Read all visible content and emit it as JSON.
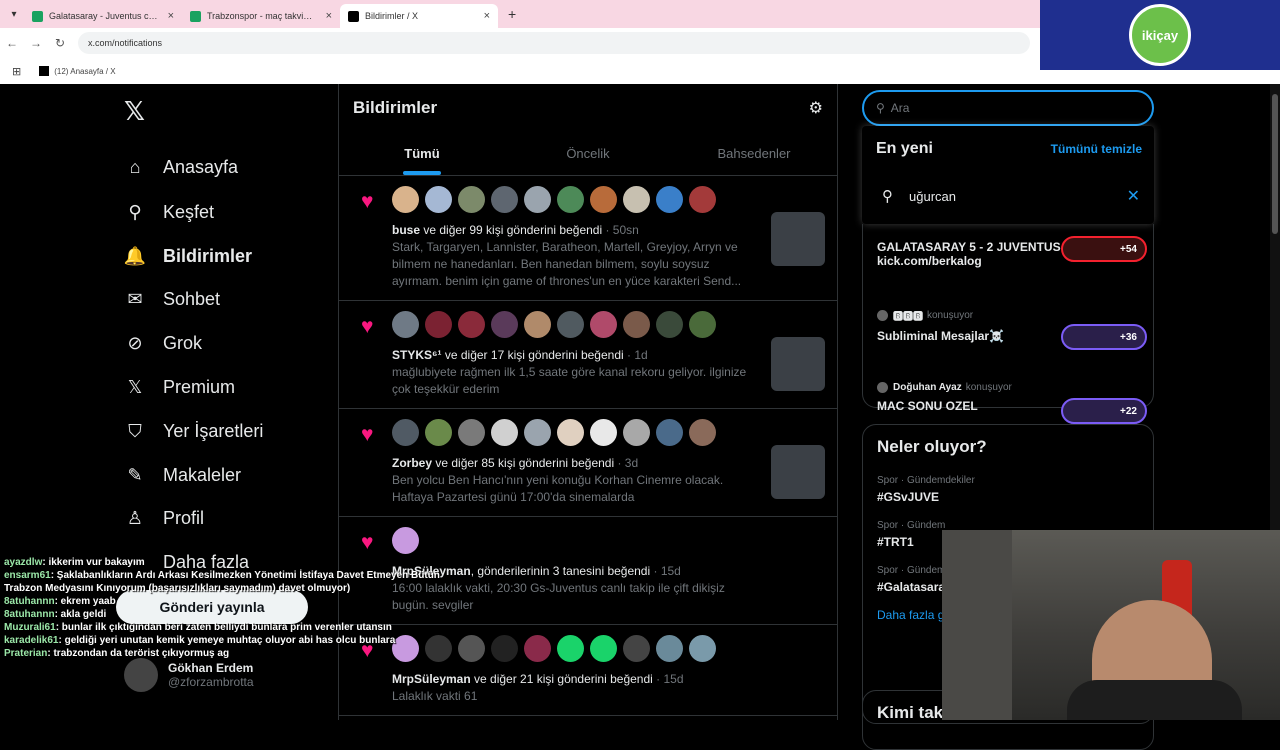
{
  "browser": {
    "tabs": [
      {
        "title": "Galatasaray - Juventus canlı sko",
        "color": "#1aa260",
        "active": false
      },
      {
        "title": "Trabzonspor - maç takvimi, takı",
        "color": "#1aa260",
        "active": false
      },
      {
        "title": "Bildirimler / X",
        "color": "#000000",
        "active": true
      }
    ],
    "new_tab": "+",
    "url": "x.com/notifications",
    "bookmark": "(12) Anasayfa / X"
  },
  "overlay": {
    "logo_text": "ikiçay"
  },
  "nav": {
    "items": [
      {
        "label": "Anasayfa",
        "icon": "home-icon",
        "glyph": "⌂"
      },
      {
        "label": "Keşfet",
        "icon": "search-icon",
        "glyph": "⚲"
      },
      {
        "label": "Bildirimler",
        "icon": "bell-icon",
        "glyph": "🔔"
      },
      {
        "label": "Sohbet",
        "icon": "mail-icon",
        "glyph": "✉"
      },
      {
        "label": "Grok",
        "icon": "grok-icon",
        "glyph": "⊘"
      },
      {
        "label": "Premium",
        "icon": "x-icon",
        "glyph": "𝕏"
      },
      {
        "label": "Yer İşaretleri",
        "icon": "bookmark-icon",
        "glyph": "⛉"
      },
      {
        "label": "Makaleler",
        "icon": "article-icon",
        "glyph": "✎"
      },
      {
        "label": "Profil",
        "icon": "profile-icon",
        "glyph": "♙"
      },
      {
        "label": "Daha fazla",
        "icon": "more-icon",
        "glyph": "⋯"
      }
    ],
    "post_button": "Gönderi yayınla",
    "user": {
      "name": "Gökhan Erdem",
      "handle": "@zforzambrotta"
    }
  },
  "chat": [
    {
      "name": "ayazdlw",
      "msg": ": ikkerim vur bakayım"
    },
    {
      "name": "ensarm61",
      "msg": ": Şaklabanlıkların Ardı Arkası Kesilmezken Yönetimi İstifaya Davet Etmeyen Bütün Trabzon Medyasını Kınıyorum (başarısızlıkları saymadım) davet olmuyor)"
    },
    {
      "name": "8atuhannn",
      "msg": ": ekrem yaab"
    },
    {
      "name": "8atuhannn",
      "msg": ": akla geldi"
    },
    {
      "name": "Muzurali61",
      "msg": ": bunlar ilk çıktığından beri zaten belliydi bunlara prim verenler utansın"
    },
    {
      "name": "karadelik61",
      "msg": ": geldiği yeri unutan kemik yemeye muhtaç oluyor abi has olcu bunlara"
    },
    {
      "name": "Praterian",
      "msg": ": trabzondan da terörist çıkıyormuş ag"
    }
  ],
  "main": {
    "title": "Bildirimler",
    "tabs": [
      "Tümü",
      "Öncelik",
      "Bahsedenler"
    ],
    "notifications": [
      {
        "avatar_colors": [
          "#d9b38c",
          "#a5b8d4",
          "#7c8a6a",
          "#5e6670",
          "#9aa4ae",
          "#4d8a58",
          "#b86b3a",
          "#c7c0b0",
          "#3a7fc9",
          "#a33a3a"
        ],
        "user": "buse",
        "action": " ve diğer 99 kişi gönderini beğendi",
        "time": " · 50sn",
        "body": "Stark, Targaryen, Lannister, Baratheon, Martell, Greyjoy, Arryn ve bilmem ne hanedanları. Ben hanedan bilmem, soylu soysuz ayırmam. benim için game of thrones'un en yüce karakteri Send...",
        "thumb": true
      },
      {
        "avatar_colors": [
          "#6f7a86",
          "#7b2232",
          "#8a2a3a",
          "#5a3a5a",
          "#b08a6a",
          "#505a60",
          "#b04a6a",
          "#7a5a4a",
          "#3a4a3a",
          "#4a6a3a"
        ],
        "user": "STYKS⁶¹",
        "action": " ve diğer 17 kişi gönderini beğendi",
        "time": " · 1d",
        "body": "mağlubiyete rağmen ilk 1,5 saate göre kanal rekoru geliyor. ilginize çok teşekkür ederim",
        "thumb": true
      },
      {
        "avatar_colors": [
          "#505a64",
          "#6a8a4a",
          "#7a7a7a",
          "#d0d0d0",
          "#9aa4ae",
          "#e0d0c0",
          "#e8e8e8",
          "#a8a8a8",
          "#4a6a8a",
          "#8a6a5a"
        ],
        "user": "Zorbey",
        "action": " ve diğer 85 kişi gönderini beğendi",
        "time": " · 3d",
        "body": "Ben yolcu Ben Hancı'nın yeni konuğu Korhan Cinemre olacak. Haftaya Pazartesi günü 17:00'da sinemalarda",
        "thumb": true
      },
      {
        "avatar_colors": [
          "#c89ae0"
        ],
        "user": "MrpSüleyman",
        "action": ", gönderilerinin 3 tanesini beğendi",
        "time": " · 15d",
        "body": "16:00 lalaklık vakti, 20:30 Gs-Juventus canlı takip ile çift dikişiz bugün. sevgiler",
        "thumb": false
      },
      {
        "avatar_colors": [
          "#c89ae0",
          "#333333",
          "#555555",
          "#222222",
          "#8a2a4a",
          "#1ad36a",
          "#1ad36a",
          "#444444",
          "#6a8a9a",
          "#7a9aaa"
        ],
        "user": "MrpSüleyman",
        "action": " ve diğer 21 kişi gönderini beğendi",
        "time": " · 15d",
        "body": "Lalaklık vakti 61",
        "thumb": false
      }
    ]
  },
  "right": {
    "search_placeholder": "Ara",
    "recent_title": "En yeni",
    "clear_all": "Tümünü temizle",
    "recent_query": "uğurcan",
    "spaces": [
      {
        "host": "",
        "status": "",
        "title": "GALATASARAY 5 - 2 JUVENTUS | kick.com/berkalog",
        "count": "+54",
        "color": "red"
      },
      {
        "host": "🅱🅱🅱",
        "status": "konuşuyor",
        "title": "Subliminal Mesajlar☠️",
        "count": "+36",
        "color": "purple"
      },
      {
        "host": "Doğuhan Ayaz",
        "status": "konuşuyor",
        "title": "MAC SONU OZEL",
        "count": "+22",
        "color": "purple"
      }
    ],
    "trends_title": "Neler oluyor?",
    "trends": [
      {
        "category": "Spor · Gündemdekiler",
        "tag": "#GSvJUVE"
      },
      {
        "category": "Spor · Gündem",
        "tag": "#TRT1"
      },
      {
        "category": "Spor · Gündem",
        "tag": "#Galatasara"
      }
    ],
    "show_more": "Daha fazla g",
    "who_to_follow": "Kimi tak"
  }
}
